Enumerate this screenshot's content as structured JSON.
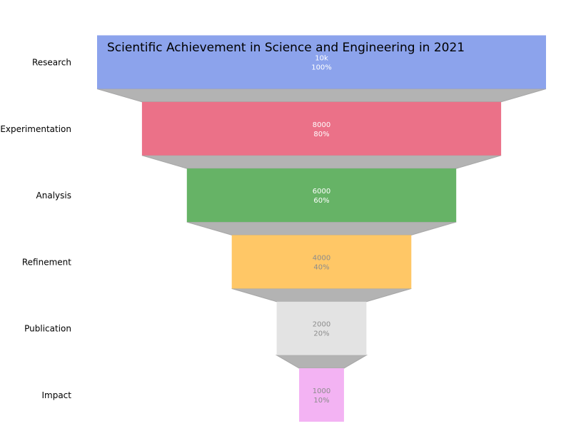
{
  "chart_data": {
    "type": "funnel",
    "title": "Scientific Achievement in Science and Engineering in 2021",
    "stages": [
      {
        "label": "Research",
        "value": 10000,
        "value_label": "10k",
        "percent_label": "100%",
        "color": "#8CA3EC",
        "text_color": "#ffffff"
      },
      {
        "label": "Experimentation",
        "value": 8000,
        "value_label": "8000",
        "percent_label": "80%",
        "color": "#EB7188",
        "text_color": "#ffffff"
      },
      {
        "label": "Analysis",
        "value": 6000,
        "value_label": "6000",
        "percent_label": "60%",
        "color": "#66B366",
        "text_color": "#ffffff"
      },
      {
        "label": "Refinement",
        "value": 4000,
        "value_label": "4000",
        "percent_label": "40%",
        "color": "#FFC766",
        "text_color": "#8c8c8c"
      },
      {
        "label": "Publication",
        "value": 2000,
        "value_label": "2000",
        "percent_label": "20%",
        "color": "#E3E3E3",
        "text_color": "#8c8c8c"
      },
      {
        "label": "Impact",
        "value": 1000,
        "value_label": "1000",
        "percent_label": "10%",
        "color": "#F3B3F3",
        "text_color": "#8c8c8c"
      }
    ],
    "connector_color": "#B3B3B3",
    "connector_edge_color": "#A6A6A6"
  }
}
